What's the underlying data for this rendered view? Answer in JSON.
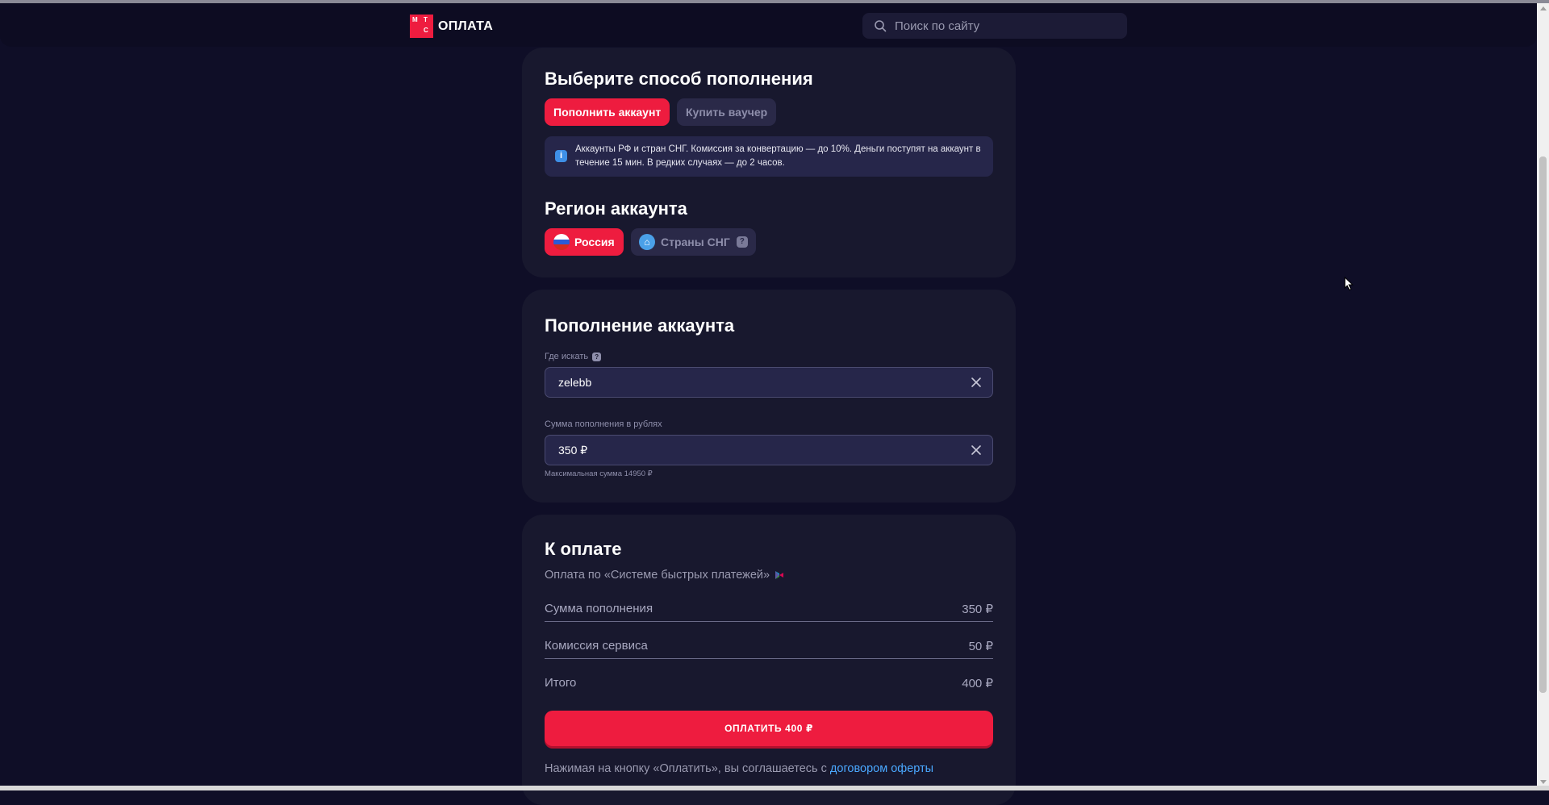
{
  "header": {
    "logo_text": "ОПЛАТА",
    "logo_letters": [
      "М",
      "Т",
      "С"
    ],
    "search_placeholder": "Поиск по сайту"
  },
  "method_card": {
    "title": "Выберите способ пополнения",
    "tabs": [
      {
        "label": "Пополнить аккаунт",
        "active": true
      },
      {
        "label": "Купить ваучер",
        "active": false
      }
    ],
    "info_text": "Аккаунты РФ и стран СНГ. Комиссия за конвертацию — до 10%. Деньги поступят на аккаунт в течение 15 мин. В редких случаях — до 2 часов.",
    "region_title": "Регион аккаунта",
    "regions": [
      {
        "label": "Россия",
        "active": true,
        "icon": "russia-flag-icon"
      },
      {
        "label": "Страны СНГ",
        "active": false,
        "icon": "globe-icon"
      }
    ],
    "info_icon_glyph": "i",
    "help_glyph": "?"
  },
  "topup_card": {
    "title": "Пополнение аккаунта",
    "account_label": "Где искать",
    "account_value": "zelebb",
    "amount_label": "Сумма пополнения в рублях",
    "amount_value": "350 ₽",
    "amount_hint": "Максимальная сумма 14950 ₽"
  },
  "payment_card": {
    "title": "К оплате",
    "subtitle": "Оплата по «Системе быстрых платежей»",
    "rows": [
      {
        "label": "Сумма пополнения",
        "value": "350 ₽"
      },
      {
        "label": "Комиссия сервиса",
        "value": "50 ₽"
      },
      {
        "label": "Итого",
        "value": "400 ₽"
      }
    ],
    "pay_button": "ОПЛАТИТЬ 400 ₽",
    "terms_text": "Нажимая на кнопку «Оплатить», вы соглашаетесь с ",
    "terms_link": "договором оферты"
  },
  "colors": {
    "accent": "#ee1c3f",
    "background": "#0f0e27",
    "card": "#18182e",
    "link": "#4aa8ff"
  }
}
